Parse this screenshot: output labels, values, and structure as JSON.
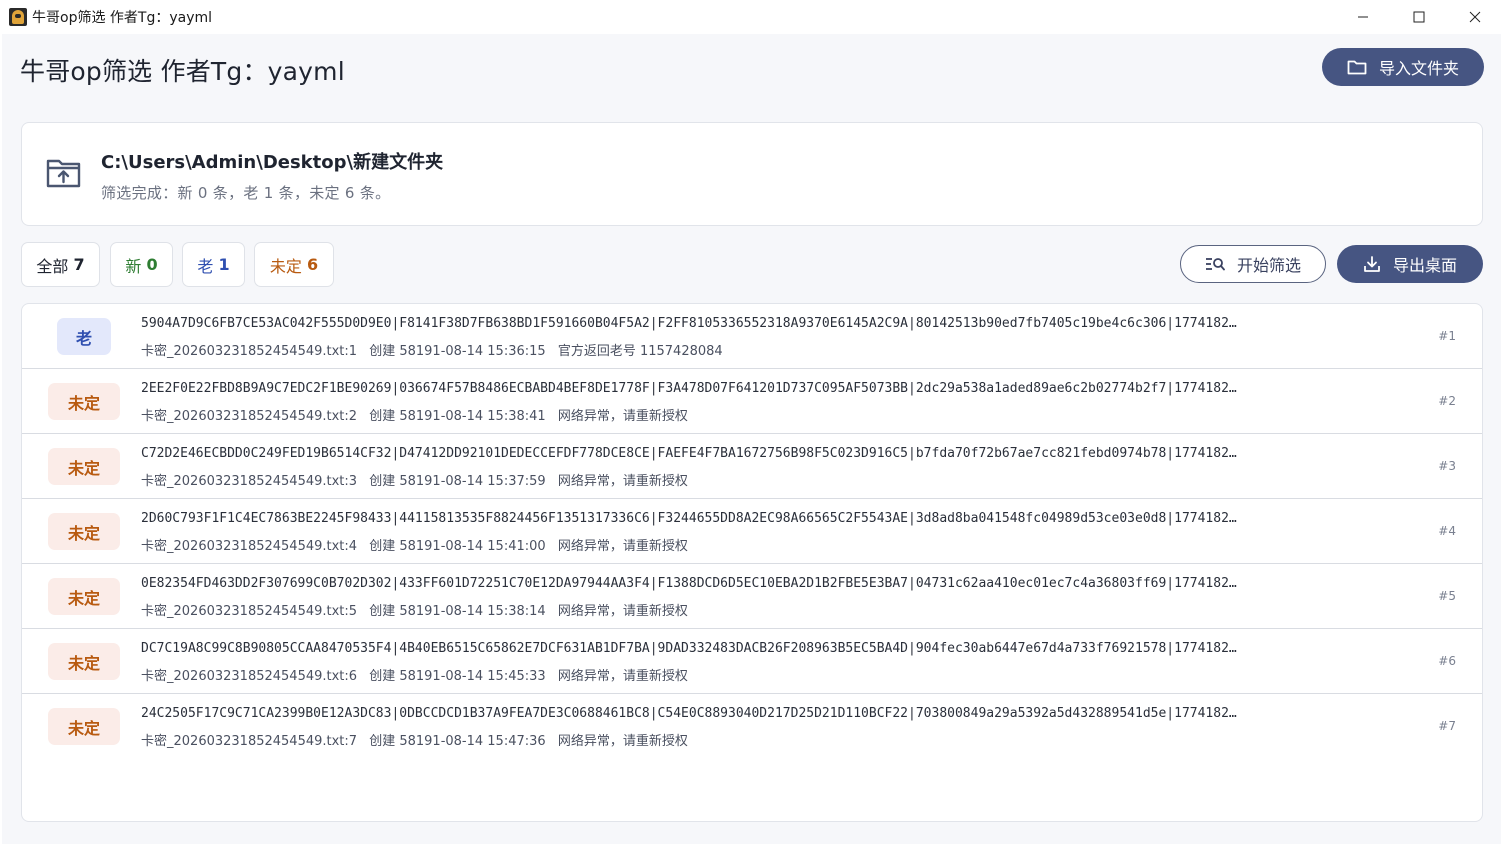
{
  "window": {
    "title": "牛哥op筛选 作者Tg：yayml",
    "controls": [
      "minimize-icon",
      "maximize-icon",
      "close-icon"
    ]
  },
  "header": {
    "title": "牛哥op筛选 作者Tg：yayml",
    "import_label": "导入文件夹"
  },
  "folder": {
    "path": "C:\\Users\\Admin\\Desktop\\新建文件夹",
    "status": "筛选完成：新 0 条，老 1 条，未定 6 条。"
  },
  "filters": [
    {
      "label": "全部",
      "count": "7"
    },
    {
      "label": "新",
      "count": "0"
    },
    {
      "label": "老",
      "count": "1"
    },
    {
      "label": "未定",
      "count": "6"
    }
  ],
  "actions": {
    "start_label": "开始筛选",
    "export_label": "导出桌面"
  },
  "colors": {
    "primary": "#465582",
    "new": "#2e7d32",
    "old": "#2f4fb0",
    "pending": "#b85a10"
  },
  "rows": [
    {
      "status": "老",
      "main": "5904A7D9C6FB7CE53AC042F555D0D9E0|F8141F38D7FB638BD1F591660B04F5A2|F2FF8105336552318A9370E6145A2C9A|80142513b90ed7fb7405c19be4c6c306|1774182…",
      "file": "卡密_20260323185245454 9.txt:1",
      "created": "创建 58191-08-14 15:36:15",
      "note": "官方返回老号 1157428084",
      "index": "#1"
    },
    {
      "status": "未定",
      "main": "2EE2F0E22FBD8B9A9C7EDC2F1BE90269|036674F57B8486ECBABD4BEF8DE1778F|F3A478D07F641201D737C095AF5073BB|2dc29a538a1aded89ae6c2b02774b2f7|1774182…",
      "file": "卡密_202603231852454549.txt:2",
      "created": "创建 58191-08-14 15:38:41",
      "note": "网络异常，请重新授权",
      "index": "#2"
    },
    {
      "status": "未定",
      "main": "C72D2E46ECBDD0C249FED19B6514CF32|D47412DD92101DEDECCEFDF778DCE8CE|FAEFE4F7BA1672756B98F5C023D916C5|b7fda70f72b67ae7cc821febd0974b78|1774182…",
      "file": "卡密_202603231852454549.txt:3",
      "created": "创建 58191-08-14 15:37:59",
      "note": "网络异常，请重新授权",
      "index": "#3"
    },
    {
      "status": "未定",
      "main": "2D60C793F1F1C4EC7863BE2245F98433|44115813535F8824456F1351317336C6|F3244655DD8A2EC98A66565C2F5543AE|3d8ad8ba041548fc04989d53ce03e0d8|1774182…",
      "file": "卡密_202603231852454549.txt:4",
      "created": "创建 58191-08-14 15:41:00",
      "note": "网络异常，请重新授权",
      "index": "#4"
    },
    {
      "status": "未定",
      "main": "0E82354FD463DD2F307699C0B702D302|433FF601D72251C70E12DA97944AA3F4|F1388DCD6D5EC10EBA2D1B2FBE5E3BA7|04731c62aa410ec01ec7c4a36803ff69|1774182…",
      "file": "卡密_202603231852454549.txt:5",
      "created": "创建 58191-08-14 15:38:14",
      "note": "网络异常，请重新授权",
      "index": "#5"
    },
    {
      "status": "未定",
      "main": "DC7C19A8C99C8B90805CCAA8470535F4|4B40EB6515C65862E7DCF631AB1DF7BA|9DAD332483DACB26F208963B5EC5BA4D|904fec30ab6447e67d4a733f76921578|1774182…",
      "file": "卡密_202603231852454549.txt:6",
      "created": "创建 58191-08-14 15:45:33",
      "note": "网络异常，请重新授权",
      "index": "#6"
    },
    {
      "status": "未定",
      "main": "24C2505F17C9C71CA2399B0E12A3DC83|0DBCCDCD1B37A9FEA7DE3C0688461BC8|C54E0C8893040D217D25D21D110BCF22|703800849a29a5392a5d432889541d5e|1774182…",
      "file": "卡密_202603231852454549.txt:7",
      "created": "创建 58191-08-14 15:47:36",
      "note": "网络异常，请重新授权",
      "index": "#7"
    }
  ]
}
